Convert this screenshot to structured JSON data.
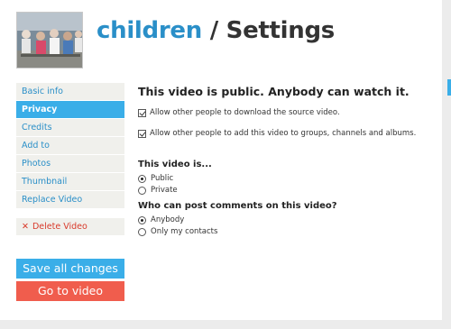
{
  "header": {
    "title_channel": "children",
    "title_separator": " / ",
    "title_page": "Settings"
  },
  "sidebar": {
    "items": [
      {
        "label": "Basic info",
        "active": false
      },
      {
        "label": "Privacy",
        "active": true
      },
      {
        "label": "Credits",
        "active": false
      },
      {
        "label": "Add to",
        "active": false
      },
      {
        "label": "Photos",
        "active": false
      },
      {
        "label": "Thumbnail",
        "active": false
      },
      {
        "label": "Replace Video",
        "active": false
      }
    ],
    "delete_icon": "✕",
    "delete_label": "Delete Video"
  },
  "actions": {
    "save_label": "Save all changes",
    "go_label": "Go to video"
  },
  "privacy": {
    "headline": "This video is public. Anybody can watch it.",
    "options": [
      {
        "label": "Allow other people to download the source video.",
        "checked": true
      },
      {
        "label": "Allow other people to add this video to groups, channels and albums.",
        "checked": true
      }
    ],
    "visibility_title": "This video is...",
    "visibility_options": [
      {
        "label": "Public",
        "selected": true
      },
      {
        "label": "Private",
        "selected": false
      }
    ],
    "comments_title": "Who can post comments on this video?",
    "comments_options": [
      {
        "label": "Anybody",
        "selected": true
      },
      {
        "label": "Only my contacts",
        "selected": false
      }
    ]
  },
  "colors": {
    "accent": "#3aaee8",
    "link": "#2a8fc8",
    "danger": "#f05d4d",
    "delete_text": "#d93a2b"
  }
}
